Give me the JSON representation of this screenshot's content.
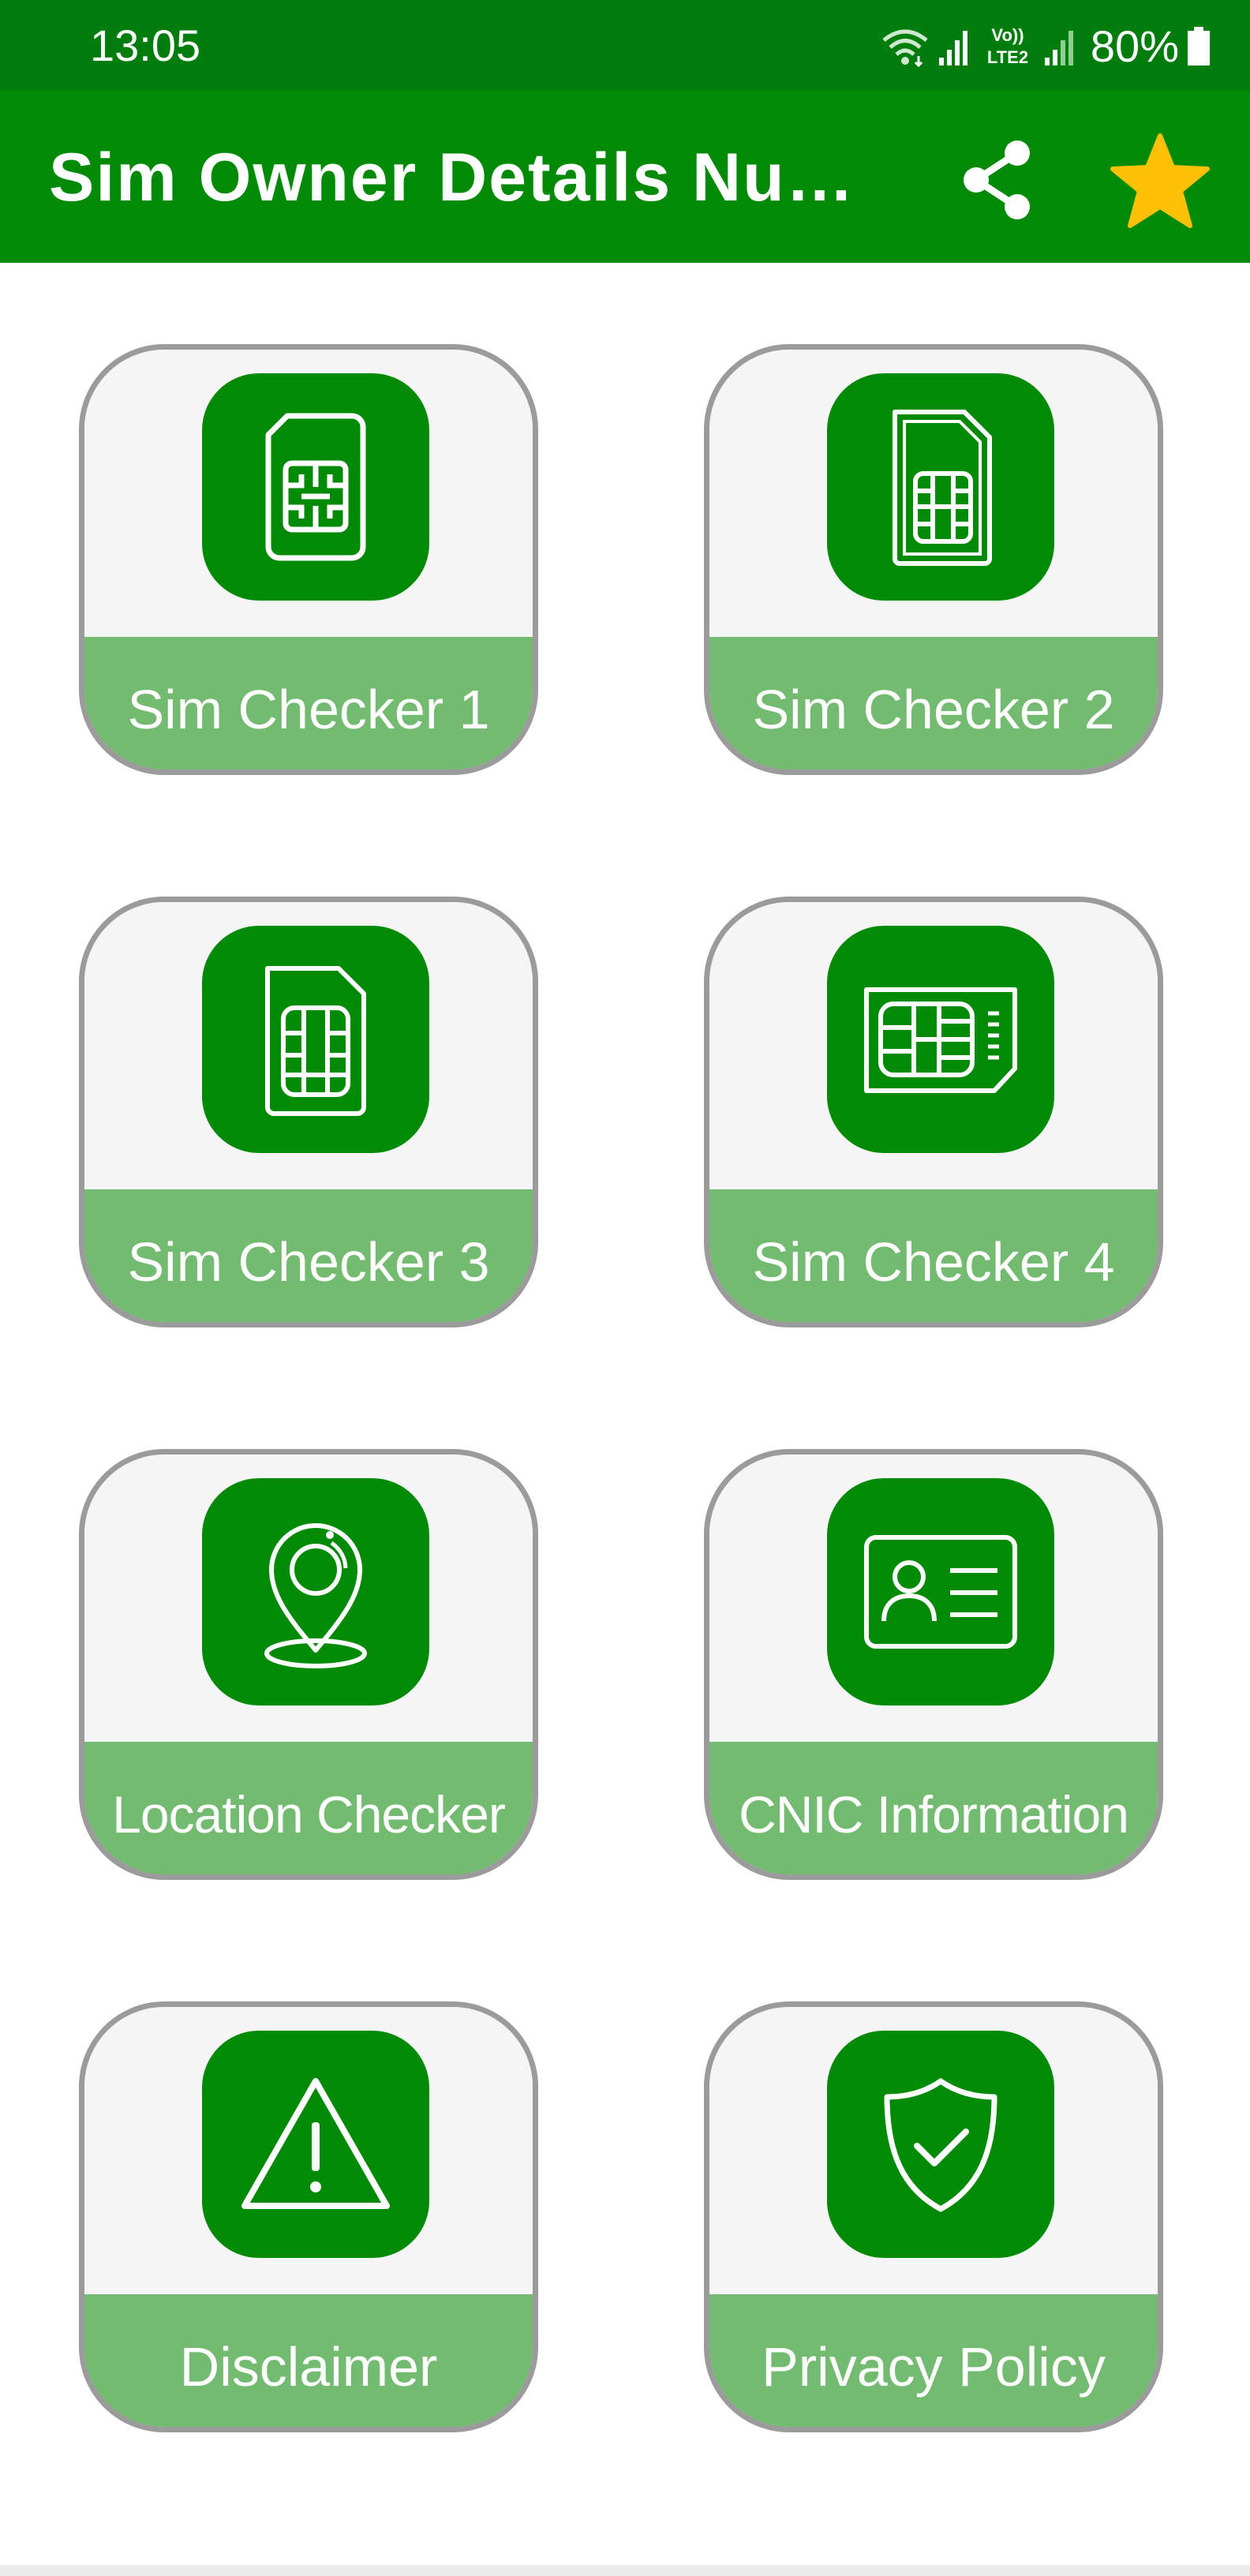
{
  "status_bar": {
    "time": "13:05",
    "network_label": "Vo)) LTE2",
    "battery": "80%"
  },
  "app_bar": {
    "title": "Sim Owner Details Number Checker",
    "share_icon": "share-icon",
    "star_icon": "star-icon"
  },
  "colors": {
    "status_bar": "#007d0c",
    "app_bar": "#008a06",
    "icon_tile": "#008a06",
    "label_band": "#73bb70",
    "card_bg": "#f5f5f5",
    "card_border": "#9b9b9b",
    "star": "#ffc107"
  },
  "cards": [
    {
      "label": "Sim Checker 1",
      "icon": "sim-card-icon"
    },
    {
      "label": "Sim Checker 2",
      "icon": "sim-card-icon"
    },
    {
      "label": "Sim Checker 3",
      "icon": "sim-card-icon"
    },
    {
      "label": "Sim Checker 4",
      "icon": "sim-card-icon"
    },
    {
      "label": "Location Checker",
      "icon": "location-pin-icon"
    },
    {
      "label": "CNIC Information",
      "icon": "id-card-icon"
    },
    {
      "label": "Disclaimer",
      "icon": "warning-icon"
    },
    {
      "label": "Privacy Policy",
      "icon": "shield-check-icon"
    }
  ]
}
